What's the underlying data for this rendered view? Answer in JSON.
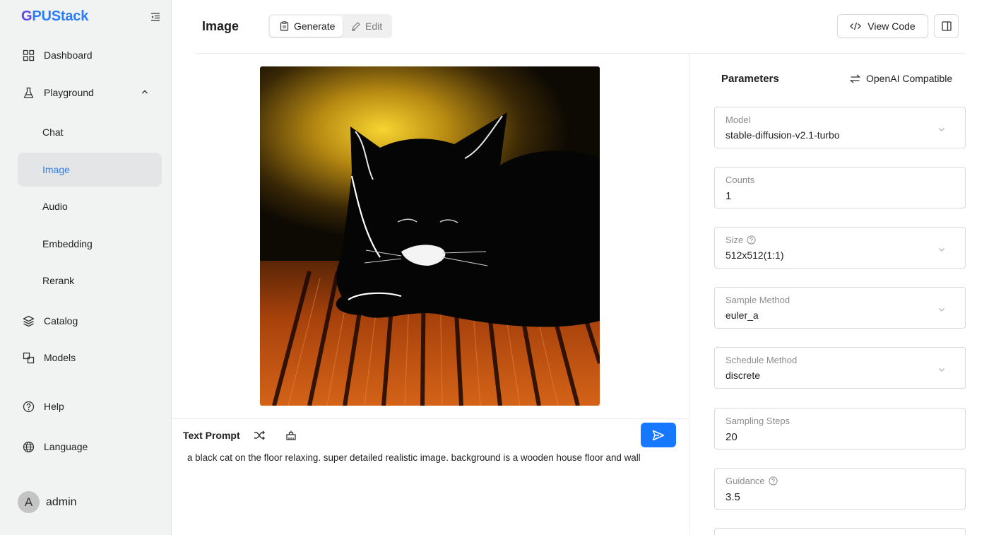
{
  "app": {
    "logo_prefix": "G",
    "logo_rest": "PUStack"
  },
  "sidebar": {
    "items": [
      {
        "label": "Dashboard"
      },
      {
        "label": "Playground"
      },
      {
        "label": "Chat"
      },
      {
        "label": "Image"
      },
      {
        "label": "Audio"
      },
      {
        "label": "Embedding"
      },
      {
        "label": "Rerank"
      },
      {
        "label": "Catalog"
      },
      {
        "label": "Models"
      },
      {
        "label": "Help"
      },
      {
        "label": "Language"
      }
    ],
    "user": {
      "initial": "A",
      "name": "admin"
    }
  },
  "header": {
    "title": "Image",
    "tabs": [
      {
        "label": "Generate",
        "selected": true
      },
      {
        "label": "Edit",
        "selected": false
      }
    ],
    "view_code": "View Code"
  },
  "prompt": {
    "label": "Text Prompt",
    "text": "a black cat on the floor relaxing. super detailed realistic image. background is a wooden house floor and wall"
  },
  "params": {
    "title": "Parameters",
    "openai_label": "OpenAI Compatible",
    "fields": [
      {
        "label": "Model",
        "value": "stable-diffusion-v2.1-turbo"
      },
      {
        "label": "Counts",
        "value": "1"
      },
      {
        "label": "Size",
        "value": "512x512(1:1)"
      },
      {
        "label": "Sample Method",
        "value": "euler_a"
      },
      {
        "label": "Schedule Method",
        "value": "discrete"
      },
      {
        "label": "Sampling Steps",
        "value": "20"
      },
      {
        "label": "Guidance",
        "value": "3.5"
      }
    ]
  },
  "colors": {
    "accent": "#1677ff",
    "active_text": "#2a7df5",
    "sidebar_bg": "#f1f2f2"
  },
  "icons": {
    "dashboard": "grid-icon",
    "playground": "flask-icon",
    "catalog": "layers-icon",
    "models": "models-icon",
    "help": "question-circle-icon",
    "language": "globe-icon",
    "shuffle": "shuffle-icon",
    "clear": "broom-icon",
    "send": "send-icon"
  }
}
